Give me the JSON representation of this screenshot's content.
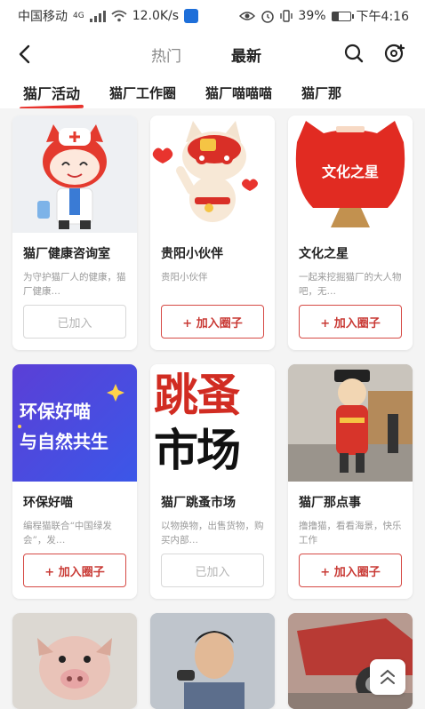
{
  "status_bar": {
    "carrier": "中国移动",
    "network": "4G",
    "speed": "12.0K/s",
    "battery": "39%",
    "time": "下午4:16"
  },
  "header": {
    "tabs": [
      {
        "label": "热门",
        "active": false
      },
      {
        "label": "最新",
        "active": true
      }
    ]
  },
  "categories": [
    {
      "label": "猫厂活动",
      "active": true
    },
    {
      "label": "猫厂工作圈",
      "active": false
    },
    {
      "label": "猫厂喵喵喵",
      "active": false
    },
    {
      "label": "猫厂那",
      "active": false
    }
  ],
  "cards": [
    {
      "title": "猫厂健康咨询室",
      "desc": "为守护猫厂人的健康，猫厂健康…",
      "button": "已加入",
      "joined": true
    },
    {
      "title": "贵阳小伙伴",
      "desc": "贵阳小伙伴",
      "button": "+ 加入圈子",
      "joined": false
    },
    {
      "title": "文化之星",
      "desc": "一起来挖掘猫厂的大人物吧，无…",
      "button": "+ 加入圈子",
      "joined": false,
      "poster_text": "文化之星"
    },
    {
      "title": "环保好喵",
      "desc": "编程猫联合“中国绿发会”，发…",
      "button": "+ 加入圈子",
      "joined": false,
      "poster_text": [
        "环保好喵",
        "与自然共生"
      ]
    },
    {
      "title": "猫厂跳蚤市场",
      "desc": "以物换物，出售货物，购买内部…",
      "button": "已加入",
      "joined": true,
      "poster_text": [
        "跳蚤",
        "市场"
      ]
    },
    {
      "title": "猫厂那点事",
      "desc": "撸撸猫，看看海景，快乐工作",
      "button": "+ 加入圈子",
      "joined": false
    }
  ],
  "colors": {
    "accent": "#e8342e",
    "button_border": "#d64a45",
    "joined_border": "#d8d8d8"
  }
}
